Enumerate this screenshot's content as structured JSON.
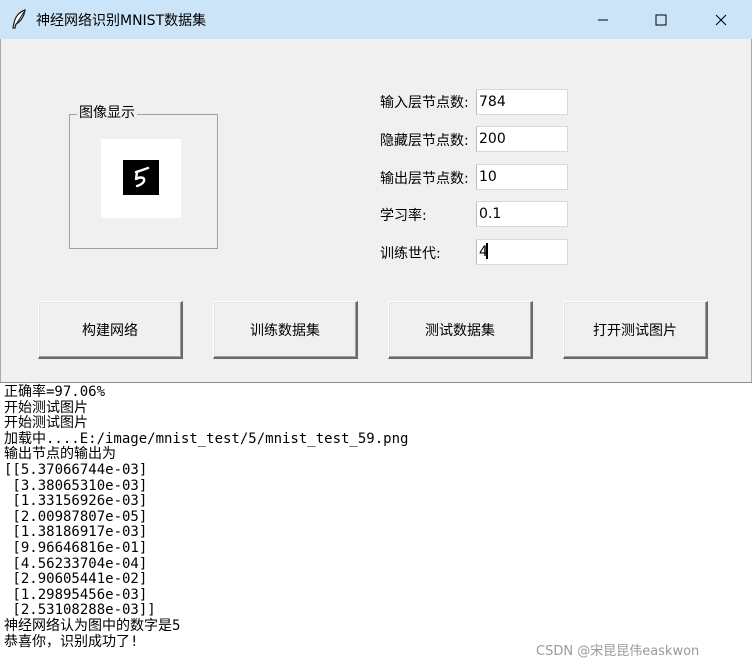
{
  "window": {
    "title": "神经网络识别MNIST数据集"
  },
  "image_panel": {
    "label": "图像显示"
  },
  "form": {
    "input_nodes": {
      "label": "输入层节点数:",
      "value": "784"
    },
    "hidden_nodes": {
      "label": "隐藏层节点数:",
      "value": "200"
    },
    "output_nodes": {
      "label": "输出层节点数:",
      "value": "10"
    },
    "learning_rate": {
      "label": "学习率:",
      "value": "0.1"
    },
    "epochs": {
      "label": "训练世代:",
      "value": "4"
    }
  },
  "buttons": {
    "build": "构建网络",
    "train": "训练数据集",
    "test": "测试数据集",
    "open_image": "打开测试图片"
  },
  "log": [
    "正确率=97.06%",
    "开始测试图片",
    "开始测试图片",
    "加载中....E:/image/mnist_test/5/mnist_test_59.png",
    "输出节点的输出为",
    "[[5.37066744e-03]",
    " [3.38065310e-03]",
    " [1.33156926e-03]",
    " [2.00987807e-05]",
    " [1.38186917e-03]",
    " [9.96646816e-01]",
    " [4.56233704e-04]",
    " [2.90605441e-02]",
    " [1.29895456e-03]",
    " [2.53108288e-03]]",
    "神经网络认为图中的数字是5",
    "恭喜你，识别成功了!"
  ],
  "watermark": "CSDN @宋昆昆伟easkwon",
  "icons": {
    "app": "feather-icon",
    "minimize": "minimize-icon",
    "maximize": "maximize-icon",
    "close": "close-icon"
  },
  "colors": {
    "titlebar": "#cce4f7",
    "window_bg": "#f0f0f0",
    "text_area_bg": "#ffffff"
  }
}
